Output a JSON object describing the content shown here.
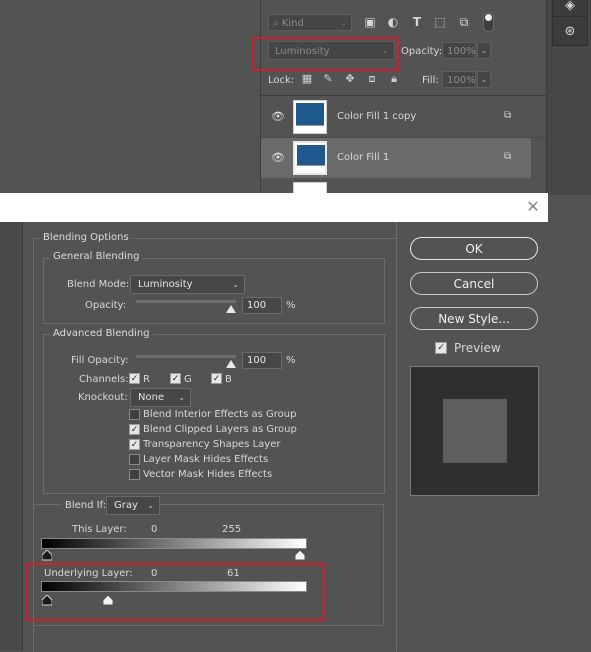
{
  "layers_panel": {
    "kind_label": "Kind",
    "blend_mode": "Luminosity",
    "opacity_label": "Opacity:",
    "opacity_value": "100%",
    "lock_label": "Lock:",
    "fill_label": "Fill:",
    "fill_value": "100%",
    "layers": [
      {
        "name": "Color Fill 1 copy",
        "color": "#1f5a8f",
        "selected": false
      },
      {
        "name": "Color Fill 1",
        "color": "#1f5a8f",
        "selected": true
      }
    ]
  },
  "dialog": {
    "close_icon": "close-icon",
    "blending_options_title": "Blending Options",
    "general": {
      "title": "General Blending",
      "blend_mode_label": "Blend Mode:",
      "blend_mode_value": "Luminosity",
      "opacity_label": "Opacity:",
      "opacity_value": "100",
      "percent": "%"
    },
    "advanced": {
      "title": "Advanced Blending",
      "fill_opacity_label": "Fill Opacity:",
      "fill_opacity_value": "100",
      "percent": "%",
      "channels_label": "Channels:",
      "channels": [
        {
          "label": "R",
          "checked": true
        },
        {
          "label": "G",
          "checked": true
        },
        {
          "label": "B",
          "checked": true
        }
      ],
      "knockout_label": "Knockout:",
      "knockout_value": "None",
      "options": [
        {
          "label": "Blend Interior Effects as Group",
          "checked": false
        },
        {
          "label": "Blend Clipped Layers as Group",
          "checked": true
        },
        {
          "label": "Transparency Shapes Layer",
          "checked": true
        },
        {
          "label": "Layer Mask Hides Effects",
          "checked": false
        },
        {
          "label": "Vector Mask Hides Effects",
          "checked": false
        }
      ]
    },
    "blend_if": {
      "label": "Blend If:",
      "value": "Gray",
      "this_layer_label": "This Layer:",
      "this_layer_low": "0",
      "this_layer_high": "255",
      "underlying_label": "Underlying Layer:",
      "underlying_low": "0",
      "underlying_high": "61"
    },
    "buttons": {
      "ok": "OK",
      "cancel": "Cancel",
      "new_style": "New Style...",
      "preview_label": "Preview",
      "preview_checked": true
    }
  },
  "colors": {
    "highlight": "#d0202a",
    "layer_fill": "#1f5a8f"
  }
}
